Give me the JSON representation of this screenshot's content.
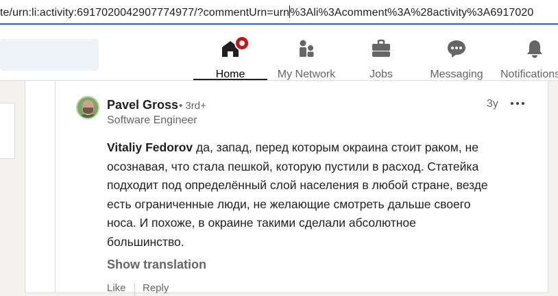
{
  "browser": {
    "url_before_caret": "te/urn:li:activity:6917020042907774977/?commentUrn=urn",
    "url_after_caret": "%3Ali%3Acomment%3A%28activity%3A6917020"
  },
  "nav": {
    "items": [
      {
        "label": "Home",
        "icon": "home-icon",
        "active": true
      },
      {
        "label": "My Network",
        "icon": "people-icon",
        "active": false
      },
      {
        "label": "Jobs",
        "icon": "briefcase-icon",
        "active": false
      },
      {
        "label": "Messaging",
        "icon": "chat-icon",
        "active": false
      },
      {
        "label": "Notifications",
        "icon": "bell-icon",
        "active": false
      }
    ]
  },
  "comment": {
    "author": "Pavel Gross",
    "degree": "• 3rd+",
    "headline": "Software Engineer",
    "time": "3y",
    "mention": "Vitaliy Fedorov",
    "text_lines": [
      " да, запад, перед которым окраина стоит раком, не",
      "осознавая, что стала пешкой, которую пустили в расход. Статейка",
      "подходит под определённый слой населения в любой стране, везде",
      "есть ограниченные люди, не желающие смотреть дальше своего",
      "носа. И похоже, в окраине такими сделали абсолютное",
      "большинство."
    ],
    "show_translation": "Show translation",
    "like_label": "Like",
    "reply_label": "Reply"
  },
  "colors": {
    "accent_underline": "#2a63c8",
    "notification_badge": "#cc1016",
    "text_primary": "#1f1f1f",
    "text_secondary": "#666666"
  }
}
